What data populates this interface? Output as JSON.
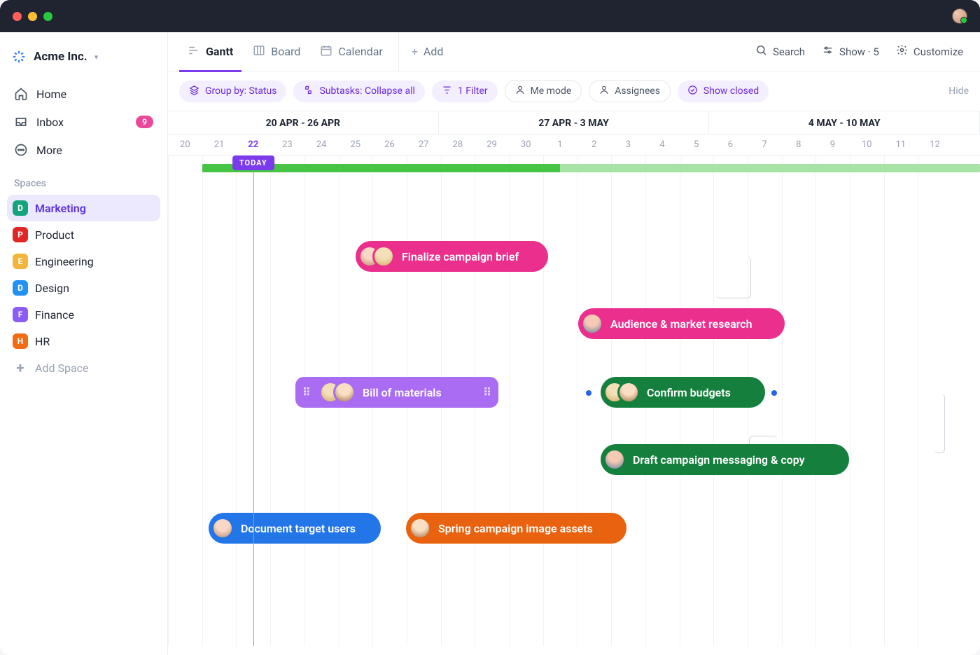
{
  "workspace": {
    "name": "Acme Inc."
  },
  "nav": {
    "home": "Home",
    "inbox": "Inbox",
    "inbox_count": "9",
    "more": "More"
  },
  "spaces": {
    "title": "Spaces",
    "items": [
      {
        "letter": "D",
        "label": "Marketing",
        "color": "#15a37f",
        "active": true
      },
      {
        "letter": "P",
        "label": "Product",
        "color": "#e02725"
      },
      {
        "letter": "E",
        "label": "Engineering",
        "color": "#f2b63d"
      },
      {
        "letter": "D",
        "label": "Design",
        "color": "#2191f3"
      },
      {
        "letter": "F",
        "label": "Finance",
        "color": "#8b5cf6"
      },
      {
        "letter": "H",
        "label": "HR",
        "color": "#f26c12"
      }
    ],
    "add": "Add Space"
  },
  "tabs": {
    "gantt": "Gantt",
    "board": "Board",
    "calendar": "Calendar",
    "add": "Add"
  },
  "toolbar": {
    "search": "Search",
    "show": "Show · 5",
    "customize": "Customize"
  },
  "filters": {
    "group_by": "Group by: Status",
    "subtasks": "Subtasks: Collapse all",
    "one_filter": "1 Filter",
    "me_mode": "Me mode",
    "assignees": "Assignees",
    "show_closed": "Show closed",
    "hide": "Hide"
  },
  "timeline": {
    "weeks": [
      "20 APR - 26 APR",
      "27 APR - 3 MAY",
      "4 MAY - 10 MAY"
    ],
    "days": [
      "20",
      "21",
      "22",
      "23",
      "24",
      "25",
      "26",
      "27",
      "28",
      "29",
      "30",
      "1",
      "2",
      "3",
      "4",
      "5",
      "6",
      "7",
      "8",
      "9",
      "10",
      "11",
      "12"
    ],
    "today_index": 2,
    "today_label": "TODAY"
  },
  "tasks": {
    "finalize": "Finalize campaign brief",
    "audience": "Audience & market research",
    "bill": "Bill of materials",
    "confirm": "Confirm budgets",
    "draft": "Draft campaign messaging & copy",
    "document": "Document target users",
    "spring": "Spring campaign image assets"
  }
}
